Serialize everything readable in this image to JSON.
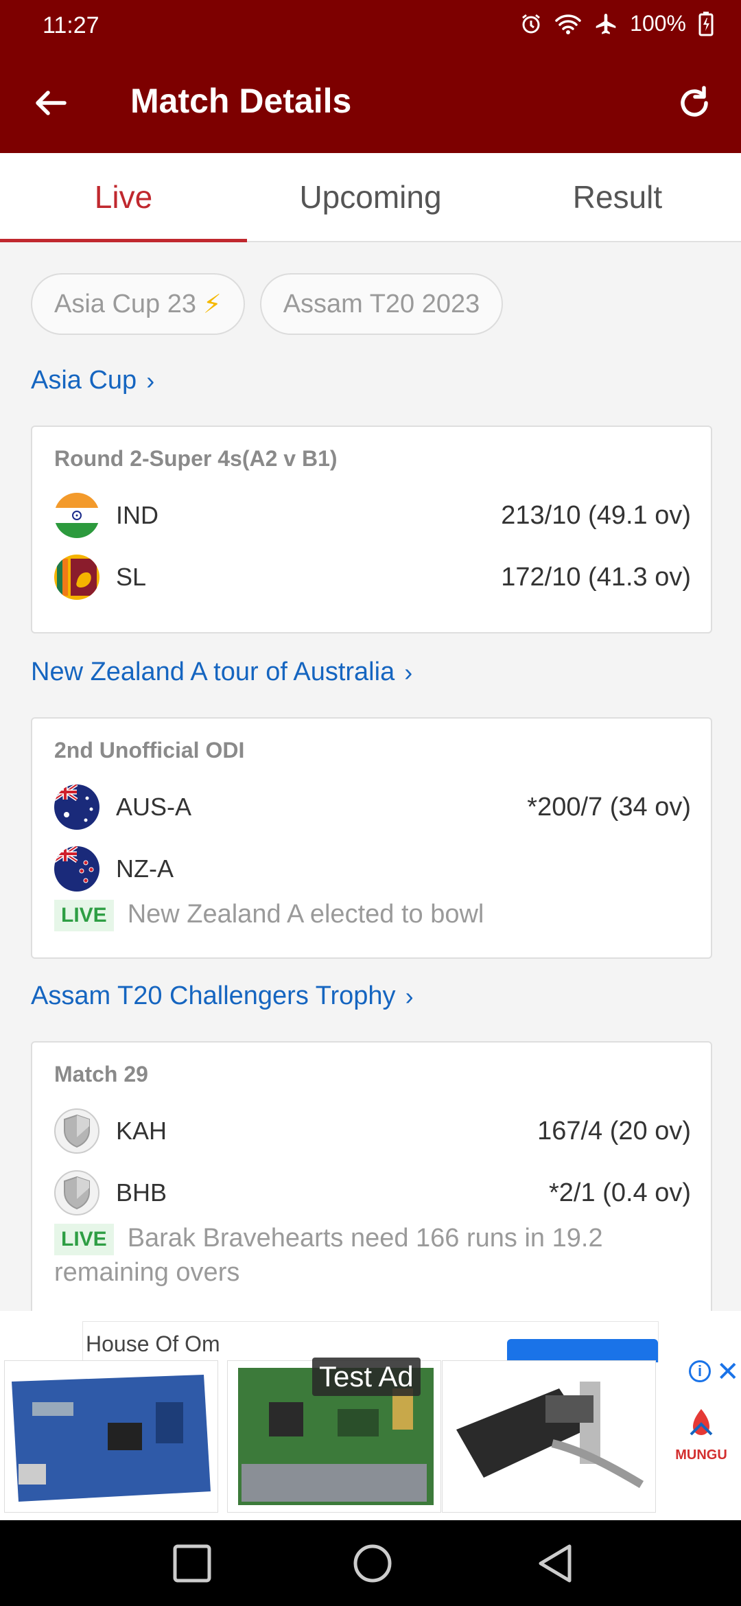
{
  "status": {
    "time": "11:27",
    "battery": "100%"
  },
  "appbar": {
    "title": "Match Details",
    "back_icon": "arrow-left",
    "refresh_icon": "refresh"
  },
  "tabs": [
    {
      "label": "Live",
      "active": true
    },
    {
      "label": "Upcoming",
      "active": false
    },
    {
      "label": "Result",
      "active": false
    }
  ],
  "chips": [
    {
      "label": "Asia Cup 23",
      "icon": "lightning-bolt"
    },
    {
      "label": "Assam T20 2023"
    }
  ],
  "series": [
    {
      "name": "Asia Cup",
      "matches": [
        {
          "title": "Round 2-Super 4s(A2 v B1)",
          "teams": [
            {
              "name": "IND",
              "score": "213/10 (49.1 ov)",
              "flag": "india"
            },
            {
              "name": "SL",
              "score": "172/10 (41.3 ov)",
              "flag": "sri-lanka"
            }
          ]
        }
      ]
    },
    {
      "name": "New Zealand A tour of Australia",
      "matches": [
        {
          "title": "2nd Unofficial ODI",
          "teams": [
            {
              "name": "AUS-A",
              "score": "*200/7 (34 ov)",
              "flag": "australia"
            },
            {
              "name": "NZ-A",
              "score": "",
              "flag": "new-zealand"
            }
          ],
          "live_badge": "LIVE",
          "status": "New Zealand A elected to bowl"
        }
      ]
    },
    {
      "name": "Assam T20 Challengers Trophy",
      "matches": [
        {
          "title": "Match 29",
          "teams": [
            {
              "name": "KAH",
              "score": "167/4 (20 ov)",
              "flag": "shield"
            },
            {
              "name": "BHB",
              "score": "*2/1 (0.4 ov)",
              "flag": "shield"
            }
          ],
          "live_badge": "LIVE",
          "status": "Barak Bravehearts need 166 runs in 19.2 remaining overs"
        }
      ]
    }
  ],
  "ad": {
    "advertiser": "House Of Om",
    "test_label": "Test Ad",
    "brand": "MUNGU"
  },
  "colors": {
    "primary": "#7d0000",
    "accent": "#c0282e",
    "link": "#1565c0",
    "live": "#2e9e44"
  }
}
